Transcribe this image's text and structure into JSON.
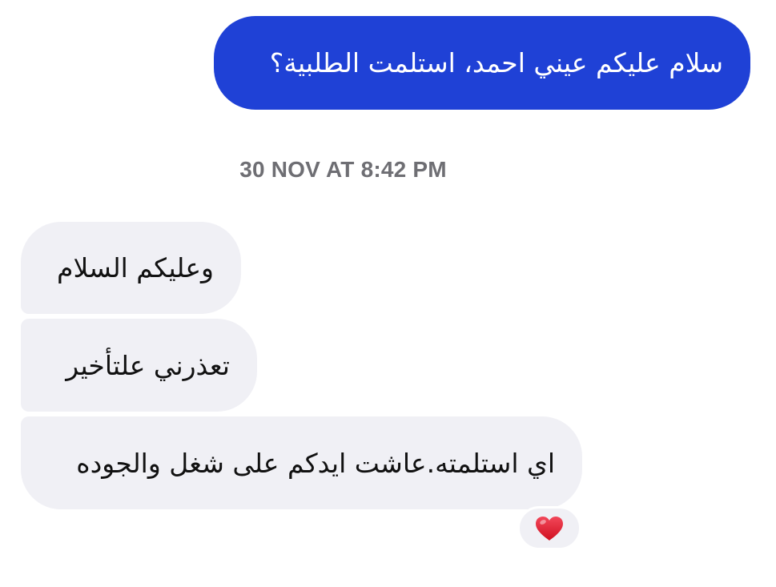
{
  "conversation": {
    "outgoing_message": "سلام عليكم عيني احمد، استلمت الطلبية؟",
    "timestamp": "30 NOV AT 8:42 PM",
    "incoming_messages": [
      "وعليكم السلام",
      "تعذرني علتأخير",
      "اي استلمته.عاشت ايدكم على شغل والجوده"
    ],
    "reaction": {
      "icon": "red-heart-icon",
      "color": "#e0202e"
    }
  },
  "colors": {
    "outgoing_bubble": "#1f41d6",
    "incoming_bubble": "#f0f0f5",
    "timestamp_text": "#6e6e73"
  }
}
